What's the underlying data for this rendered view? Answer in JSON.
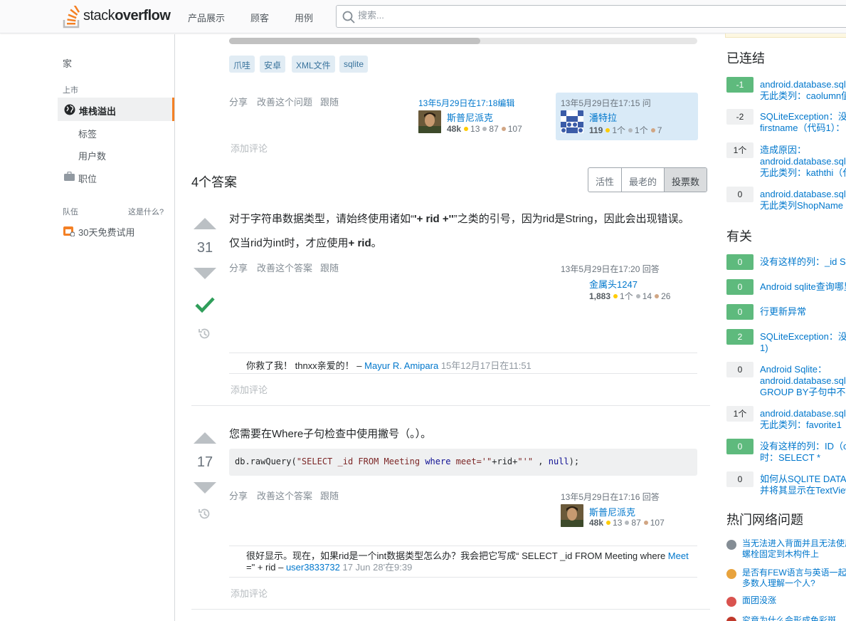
{
  "header": {
    "logo_light": "stack",
    "logo_bold": "overflow",
    "nav": [
      "产品展示",
      "顾客",
      "用例"
    ],
    "search_placeholder": "搜索..."
  },
  "leftnav": {
    "home": "家",
    "public": "上市",
    "stackoverflow": "堆栈溢出",
    "tags": "标签",
    "users": "用户数",
    "jobs": "职位",
    "teams": "队伍",
    "what": "这是什么?",
    "trial": "30天免费试用"
  },
  "question": {
    "tags": [
      "爪哇",
      "安卓",
      "XML文件",
      "sqlite"
    ],
    "actions": [
      "分享",
      "改善这个问题",
      "跟随"
    ],
    "edited": {
      "time": "13年5月29日在17:18编辑",
      "user": "斯普尼派克",
      "rep": "48k",
      "gold": "13",
      "silver": "87",
      "bronze": "107"
    },
    "asked": {
      "time": "13年5月29日在17:15 问",
      "user": "潘特拉",
      "rep": "119",
      "gold": "1个",
      "silver": "1个",
      "bronze": "7"
    },
    "add_comment": "添加评论"
  },
  "answers": {
    "heading": "4个答案",
    "tabs": [
      "活性",
      "最老的",
      "投票数"
    ],
    "list": [
      {
        "votes": "31",
        "para1_a": "对于字符串数据类型，请始终使用诸如“",
        "para1_b": "'+ rid +''",
        "para1_c": "”之类的引号，因为rid是String，因此会出现错误。",
        "para2_a": "仅当rid为int时，才应使用",
        "para2_b": "+ rid",
        "para2_c": "。",
        "actions": [
          "分享",
          "改善这个答案",
          "跟随"
        ],
        "time": "13年5月29日在17:20 回答",
        "user": "金属头1247",
        "rep": "1,883",
        "gold": "1个",
        "silver": "14",
        "bronze": "26",
        "comment_text": "你救了我！ thnxx亲爱的！ –",
        "comment_user": "Mayur R. Amipara",
        "comment_date": "15年12月17日在11:51",
        "add_comment": "添加评论"
      },
      {
        "votes": "17",
        "text": "您需要在Where子句检查中使用撇号（。）。",
        "code_a": "db.rawQuery(",
        "code_b": "\"SELECT _id FROM  Meeting   ",
        "code_c": "where",
        "code_d": " meet='\"",
        "code_e": "+rid+",
        "code_f": "\"'\"",
        "code_g": " , ",
        "code_h": "null",
        "code_i": ");",
        "actions": [
          "分享",
          "改善这个答案",
          "跟随"
        ],
        "time": "13年5月29日在17:16 回答",
        "user": "斯普尼派克",
        "rep": "48k",
        "gold": "13",
        "silver": "87",
        "bronze": "107",
        "comment_line1": "很好显示。现在，如果rid是一个int数据类型怎么办？我会把它写成“ SELECT _id FROM Meeting where ",
        "comment_line1_link": "Meet",
        "comment_line2": "=\" + rid –",
        "comment_user": "user3833732",
        "comment_date": "17 Jun 28'在9:39",
        "add_comment": "添加评论"
      }
    ]
  },
  "sidebar": {
    "linked_title": "已连结",
    "linked": [
      {
        "score": "-1",
        "lines": [
          "android.database.sql",
          "无此类列：caolumn值"
        ]
      },
      {
        "score": "-2",
        "lines": [
          "SQLiteException：没",
          "firstname（代码1）："
        ]
      },
      {
        "score": "1个",
        "lines": [
          "造成原因：",
          "android.database.sql",
          "无此类列：kaththi（代"
        ]
      },
      {
        "score": "0",
        "lines": [
          "android.database.sql",
          "无此类列ShopName"
        ]
      }
    ],
    "related_title": "有关",
    "related": [
      {
        "score": "0",
        "lines": [
          "没有这样的列：_id S"
        ]
      },
      {
        "score": "0",
        "lines": [
          "Android sqlite查询哪里"
        ]
      },
      {
        "score": "0",
        "lines": [
          "行更新异常"
        ]
      },
      {
        "score": "2",
        "lines": [
          "SQLiteException：没",
          "1)"
        ]
      },
      {
        "score": "0",
        "lines": [
          "Android Sqlite：",
          "android.database.sql",
          "GROUP BY子句中不"
        ]
      },
      {
        "score": "1个",
        "lines": [
          "android.database.sql",
          "无此类列：favorite1"
        ]
      },
      {
        "score": "0",
        "lines": [
          "没有这样的列：ID（c",
          "时：SELECT *"
        ]
      },
      {
        "score": "0",
        "lines": [
          "如何从SQLITE DATA",
          "并将其显示在TextView"
        ]
      }
    ],
    "hot_title": "热门网络问题",
    "hot": [
      {
        "lines": [
          "当无法进入背面并且无法使用",
          "螺栓固定到木构件上"
        ]
      },
      {
        "lines": [
          "是否有FEW语言与英语一起",
          "多数人理解一个人?"
        ]
      },
      {
        "lines": [
          "面团没涨"
        ]
      },
      {
        "lines": [
          "究竟为什么会形成色彩斑"
        ]
      }
    ]
  }
}
